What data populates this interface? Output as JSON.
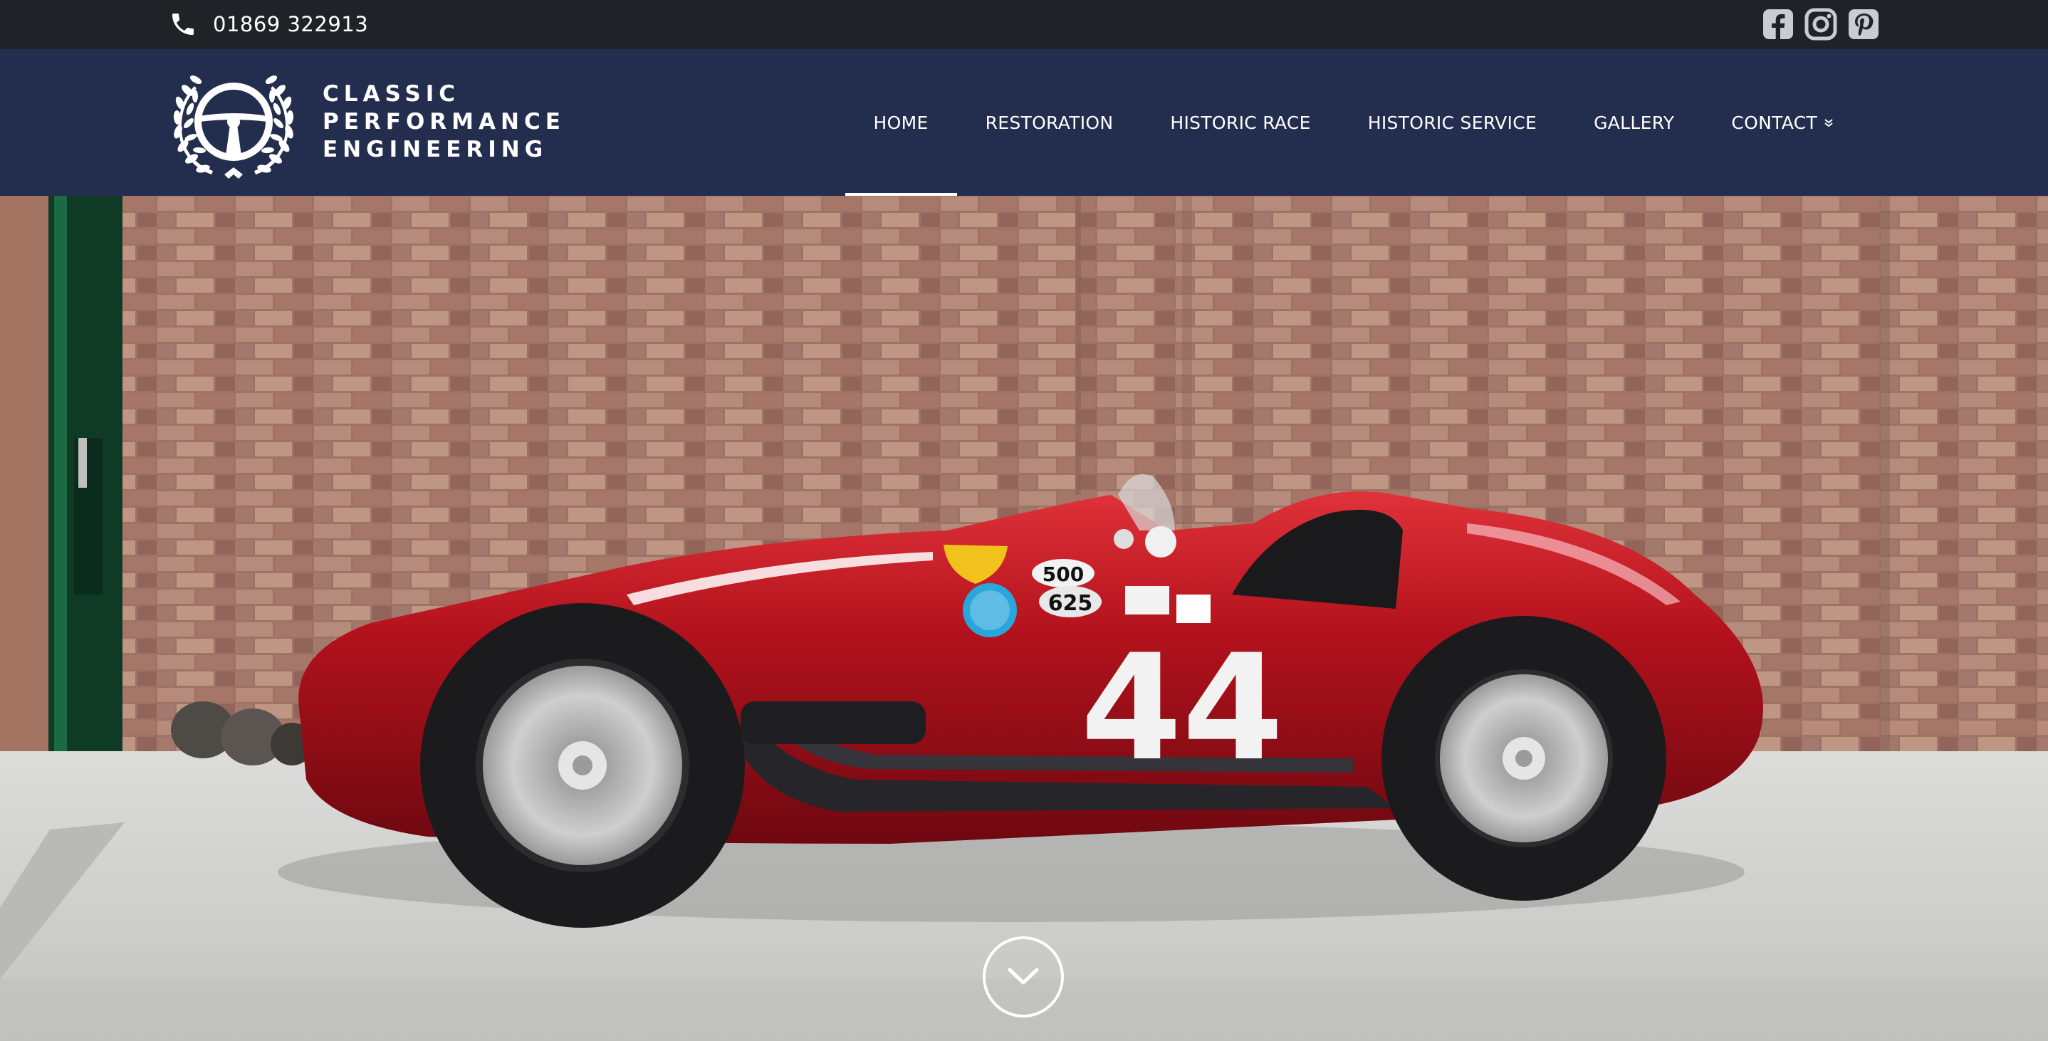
{
  "topbar": {
    "phone_icon": "phone-icon",
    "phone": "01869 322913",
    "socials": [
      "facebook-icon",
      "instagram-icon",
      "pinterest-icon"
    ]
  },
  "brand": {
    "logo_icon": "steering-wheel-laurel-icon",
    "line1": "CLASSIC",
    "line2": "PERFORMANCE",
    "line3": "ENGINEERING"
  },
  "nav": {
    "items": [
      {
        "label": "HOME",
        "active": true
      },
      {
        "label": "RESTORATION"
      },
      {
        "label": "HISTORIC RACE"
      },
      {
        "label": "HISTORIC SERVICE"
      },
      {
        "label": "GALLERY"
      },
      {
        "label": "CONTACT",
        "dropdown": true
      }
    ]
  },
  "hero": {
    "image": "red-vintage-race-car-number-44",
    "car_number": "44",
    "sticker_500": "500",
    "sticker_625": "625",
    "scroll_icon": "chevron-down-icon"
  },
  "colors": {
    "topbar": "#1f2327",
    "navbar": "#232d4d",
    "text": "#ffffff",
    "car_red": "#b3121c",
    "brick": "#a8796b"
  }
}
